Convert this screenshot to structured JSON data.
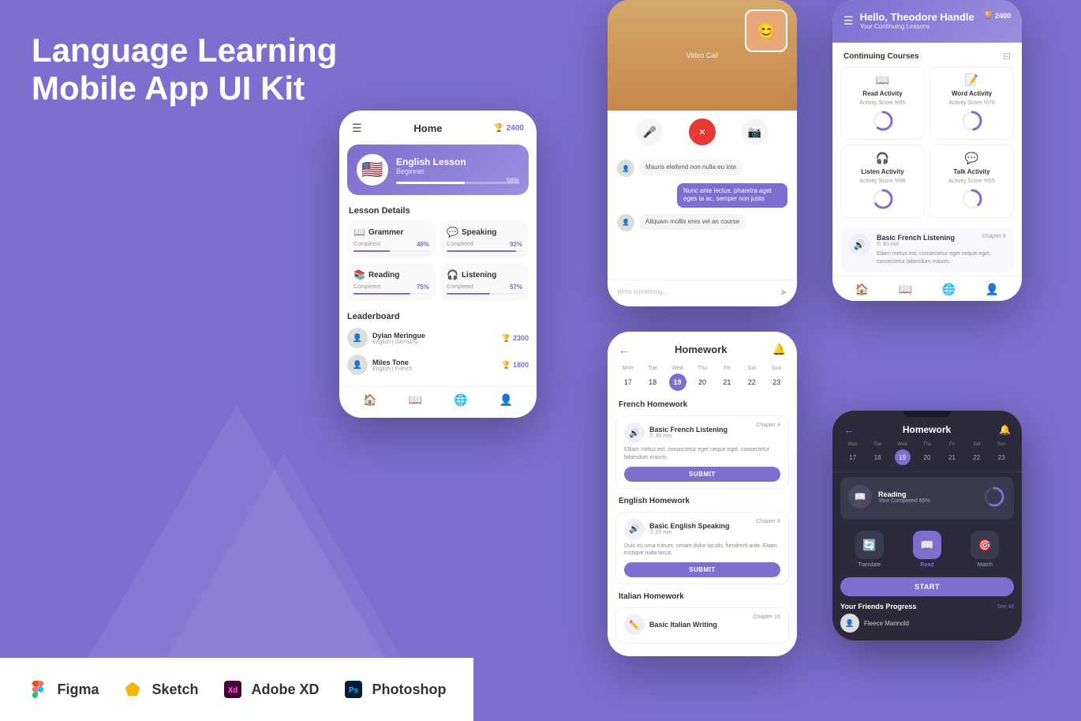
{
  "hero": {
    "title_line1": "Language Learning",
    "title_line2": "Mobile App UI Kit"
  },
  "tools": [
    {
      "name": "figma-item",
      "icon": "figma-icon",
      "label": "Figma",
      "color": "#F24E1E"
    },
    {
      "name": "sketch-item",
      "icon": "sketch-icon",
      "label": "Sketch",
      "color": "#F7B500"
    },
    {
      "name": "xd-item",
      "icon": "xd-icon",
      "label": "Adobe XD",
      "color": "#FF61F6"
    },
    {
      "name": "ps-item",
      "icon": "ps-icon",
      "label": "Photoshop",
      "color": "#31A8FF"
    }
  ],
  "phone1": {
    "header": {
      "menu": "☰",
      "title": "Home",
      "score": "2400"
    },
    "lesson": {
      "flag": "🇺🇸",
      "name": "English Lesson",
      "level": "Beginner",
      "progress": "56%",
      "fill_width": "56%"
    },
    "lesson_details_title": "Lesson Details",
    "cards": [
      {
        "icon": "📖",
        "title": "Grammer",
        "completed": "Completed",
        "percent": "48%",
        "fill": "48%"
      },
      {
        "icon": "💬",
        "title": "Speaking",
        "completed": "Completed",
        "percent": "92%",
        "fill": "92%"
      },
      {
        "icon": "📚",
        "title": "Reading",
        "completed": "Completed",
        "percent": "75%",
        "fill": "75%"
      },
      {
        "icon": "🎧",
        "title": "Listening",
        "completed": "Completed",
        "percent": "57%",
        "fill": "57%"
      }
    ],
    "leaderboard_title": "Leaderboard",
    "leaderboard": [
      {
        "name": "Dylan Meringue",
        "lang": "English | Germany",
        "score": "🏆 2300"
      },
      {
        "name": "Miles Tone",
        "lang": "English | French",
        "score": "🏆 1800"
      }
    ]
  },
  "phone2": {
    "messages": [
      {
        "type": "received",
        "text": "Mauris eleifend non nulla eu inte"
      },
      {
        "type": "sent",
        "text": "Nunc ante lectus, pharetra aget eges ta ac, semper non justo"
      },
      {
        "type": "received",
        "text": "Aliquam mollis eres vel an course"
      }
    ],
    "input_placeholder": "Write something..."
  },
  "phone3": {
    "title": "Homework",
    "calendar": {
      "days": [
        "Mon",
        "Tue",
        "Wed",
        "Thu",
        "Fri",
        "Sat",
        "Sun"
      ],
      "numbers": [
        "17",
        "18",
        "19",
        "20",
        "21",
        "22",
        "23"
      ],
      "active": "19"
    },
    "sections": [
      {
        "title": "French Homework",
        "cards": [
          {
            "icon": "🔊",
            "title": "Basic French Listening",
            "chapter": "Chapter 4",
            "time": "30 min",
            "desc": "Elliam metus est, consectetur eget neque eget, consectetur bibendum mauris.",
            "has_submit": true
          }
        ]
      },
      {
        "title": "English Homework",
        "cards": [
          {
            "icon": "🔊",
            "title": "Basic English Speaking",
            "chapter": "Chapter 8",
            "time": "20 min",
            "desc": "Duis eu urna rutrum, ornare dolor iaculis, hendrerit ante. Etiam tristique nulla lacus.",
            "has_submit": true
          }
        ]
      },
      {
        "title": "Italian Homework",
        "cards": [
          {
            "icon": "✏️",
            "title": "Basic Italian Writing",
            "chapter": "Chapter 16",
            "time": "",
            "desc": "",
            "has_submit": false
          }
        ]
      }
    ]
  },
  "phone4": {
    "greeting": "Hello, Theodore Handle",
    "subtitle": "Your Continuing Lessons",
    "score": "2400",
    "section_title": "Continuing Courses",
    "activities": [
      {
        "icon": "📖",
        "name": "Read Activity",
        "score": "Activity Score %95"
      },
      {
        "icon": "📝",
        "name": "Word Activity",
        "score": "Activity Score %70"
      },
      {
        "icon": "🎧",
        "name": "Listen Activity",
        "score": "Activity Score %98"
      },
      {
        "icon": "💬",
        "name": "Talk Activity",
        "score": "Activity Score %55"
      }
    ],
    "featured": {
      "icon": "🔊",
      "title": "Basic French Listening",
      "chapter": "Chapter 8",
      "time": "30 min",
      "desc": "Etiam metus est, consectetur eget neque eget, consectetur bibendum mauris."
    }
  },
  "phone5": {
    "title": "Homework",
    "calendar": {
      "days": [
        "Mon",
        "Tue",
        "Wed",
        "Thu",
        "Fri",
        "Sat",
        "Sun"
      ],
      "numbers": [
        "17",
        "18",
        "19",
        "20",
        "21",
        "22",
        "23"
      ],
      "active": "19"
    },
    "hw": {
      "icon": "📖",
      "title": "Reading",
      "subtitle": "Your Completed 85%"
    },
    "actions": [
      {
        "icon": "🔄",
        "label": "Translate",
        "active": false
      },
      {
        "icon": "📖",
        "label": "Read",
        "active": true
      },
      {
        "icon": "🎯",
        "label": "Match",
        "active": false
      }
    ],
    "start_label": "START",
    "friends_title": "Your Friends Progress",
    "see_all": "See All",
    "friend": {
      "name": "Fleece Marinold"
    }
  },
  "accent_color": "#7C6FCF"
}
